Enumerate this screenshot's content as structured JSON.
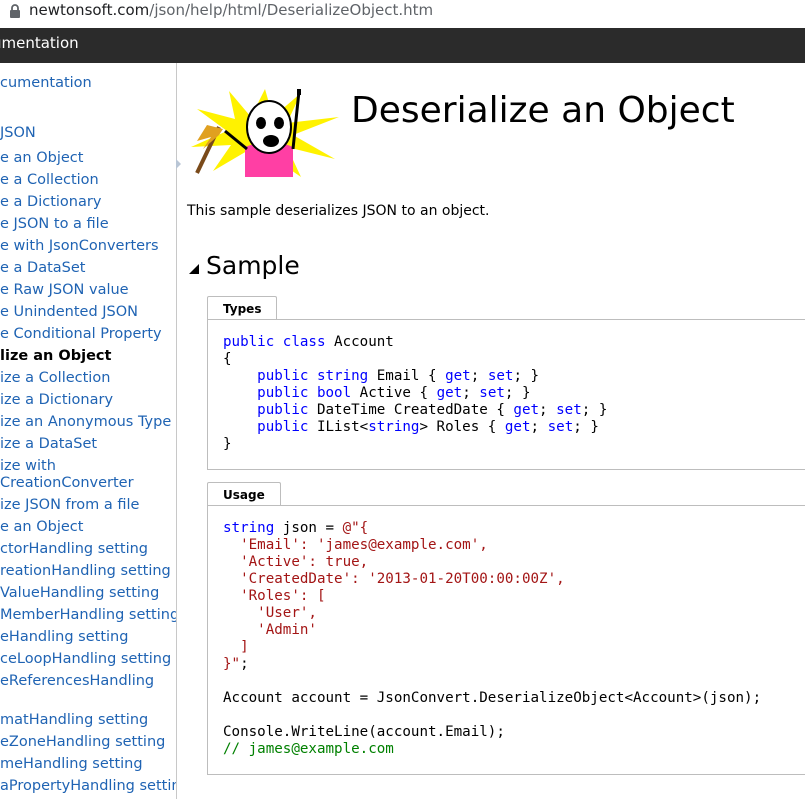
{
  "browser": {
    "url_host": "newtonsoft.com",
    "url_path": "/json/help/html/DeserializeObject.htm"
  },
  "topbar": {
    "title": "umentation"
  },
  "sidebar": {
    "items": [
      {
        "label": "cumentation",
        "selected": false
      },
      {
        "label": "JSON",
        "selected": false
      },
      {
        "label": "e an Object",
        "selected": false
      },
      {
        "label": "e a Collection",
        "selected": false
      },
      {
        "label": "e a Dictionary",
        "selected": false
      },
      {
        "label": "e JSON to a file",
        "selected": false
      },
      {
        "label": "e with JsonConverters",
        "selected": false
      },
      {
        "label": "e a DataSet",
        "selected": false
      },
      {
        "label": "e Raw JSON value",
        "selected": false
      },
      {
        "label": "e Unindented JSON",
        "selected": false
      },
      {
        "label": "e Conditional Property",
        "selected": false
      },
      {
        "label": "lize an Object",
        "selected": true
      },
      {
        "label": "ize a Collection",
        "selected": false
      },
      {
        "label": "ize a Dictionary",
        "selected": false
      },
      {
        "label": "ize an Anonymous Type",
        "selected": false
      },
      {
        "label": "ize a DataSet",
        "selected": false
      },
      {
        "label": "ize with",
        "selected": false
      },
      {
        "label": "CreationConverter",
        "selected": false
      },
      {
        "label": "ize JSON from a file",
        "selected": false
      },
      {
        "label": "e an Object",
        "selected": false
      },
      {
        "label": "ctorHandling setting",
        "selected": false
      },
      {
        "label": "reationHandling setting",
        "selected": false
      },
      {
        "label": "ValueHandling setting",
        "selected": false
      },
      {
        "label": "MemberHandling setting",
        "selected": false
      },
      {
        "label": "eHandling setting",
        "selected": false
      },
      {
        "label": "ceLoopHandling setting",
        "selected": false
      },
      {
        "label": "eReferencesHandling",
        "selected": false
      },
      {
        "label": "matHandling setting",
        "selected": false
      },
      {
        "label": "eZoneHandling setting",
        "selected": false
      },
      {
        "label": "meHandling setting",
        "selected": false
      },
      {
        "label": "aPropertyHandling setting",
        "selected": false
      }
    ]
  },
  "main": {
    "title": "Deserialize an Object",
    "intro": "This sample deserializes JSON to an object.",
    "section_title": "Sample",
    "types_tab": "Types",
    "usage_tab": "Usage"
  },
  "code": {
    "types": {
      "l1_kw1": "public",
      "l1_kw2": "class",
      "l1_rest": " Account",
      "l2": "{",
      "l3_kw1": "public",
      "l3_kw2": "string",
      "l3_a": " Email { ",
      "l3_get": "get",
      "l3_b": "; ",
      "l3_set": "set",
      "l3_c": "; }",
      "l4_kw1": "public",
      "l4_kw2": "bool",
      "l4_a": " Active { ",
      "l4_get": "get",
      "l4_b": "; ",
      "l4_set": "set",
      "l4_c": "; }",
      "l5_kw1": "public",
      "l5_a": " DateTime CreatedDate { ",
      "l5_get": "get",
      "l5_b": "; ",
      "l5_set": "set",
      "l5_c": "; }",
      "l6_kw1": "public",
      "l6_a": " IList<",
      "l6_kw2": "string",
      "l6_b": "> Roles { ",
      "l6_get": "get",
      "l6_c": "; ",
      "l6_set": "set",
      "l6_d": "; }",
      "l7": "}"
    },
    "usage": {
      "u1_kw": "string",
      "u1_rest": " json = ",
      "u1_str": "@\"{",
      "u2": "  'Email': 'james@example.com',",
      "u3": "  'Active': true,",
      "u4": "  'CreatedDate': '2013-01-20T00:00:00Z',",
      "u5": "  'Roles': [",
      "u6": "    'User',",
      "u7": "    'Admin'",
      "u8": "  ]",
      "u9_str": "}\"",
      "u9_rest": ";",
      "u10": "Account account = JsonConvert.DeserializeObject<Account>(json);",
      "u11": "Console.WriteLine(account.Email);",
      "u12": "// james@example.com"
    }
  },
  "colors": {
    "keyword": "#0000ff",
    "string": "#a31515",
    "comment": "#008000",
    "link": "#1f63b3",
    "topbar": "#2b2b2b"
  }
}
